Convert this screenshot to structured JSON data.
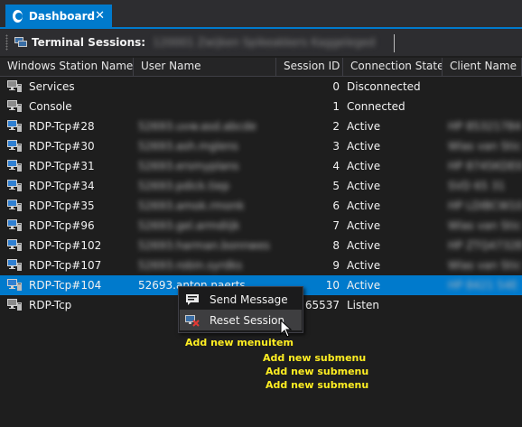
{
  "tab": {
    "title": "Dashboard",
    "close": "✕"
  },
  "toolbar": {
    "label": "Terminal Sessions:",
    "server": "120001 Zwijken Spikeakkers Kaggeleged"
  },
  "columns": [
    "Windows Station Name",
    "User Name",
    "Session ID",
    "Connection State",
    "Client Name"
  ],
  "rows": [
    {
      "station": "Services",
      "user": "",
      "id": "0",
      "state": "Disconnected",
      "client": "",
      "icon": "monitor-gray"
    },
    {
      "station": "Console",
      "user": "",
      "id": "1",
      "state": "Connected",
      "client": "",
      "icon": "monitor-gray"
    },
    {
      "station": "RDP-Tcp#28",
      "user": "52693.uvw.asd.abcde",
      "id": "2",
      "state": "Active",
      "client": "HP 85321784",
      "icon": "monitor-blue"
    },
    {
      "station": "RDP-Tcp#30",
      "user": "52693.ash.mglens",
      "id": "3",
      "state": "Active",
      "client": "Wlas van Sticht",
      "icon": "monitor-blue"
    },
    {
      "station": "RDP-Tcp#31",
      "user": "52693.ersmyplans",
      "id": "4",
      "state": "Active",
      "client": "HP 8745KDE01",
      "icon": "monitor-blue"
    },
    {
      "station": "RDP-Tcp#34",
      "user": "52693.pdick.tiep",
      "id": "5",
      "state": "Active",
      "client": "SVD 65 31",
      "icon": "monitor-blue"
    },
    {
      "station": "RDP-Tcp#35",
      "user": "52693.amok.rmonk",
      "id": "6",
      "state": "Active",
      "client": "HP LDIBCW100",
      "icon": "monitor-blue"
    },
    {
      "station": "RDP-Tcp#96",
      "user": "52693.gel.armdiijk",
      "id": "7",
      "state": "Active",
      "client": "Wlas van Sticht",
      "icon": "monitor-blue"
    },
    {
      "station": "RDP-Tcp#102",
      "user": "52693.harman.bonnwes",
      "id": "8",
      "state": "Active",
      "client": "HP ZTQ4732BKA",
      "icon": "monitor-blue"
    },
    {
      "station": "RDP-Tcp#107",
      "user": "52693.robin.syrdks",
      "id": "9",
      "state": "Active",
      "client": "Wlas van Sticht",
      "icon": "monitor-blue"
    },
    {
      "station": "RDP-Tcp#104",
      "user": "52693.anton.naerts",
      "id": "10",
      "state": "Active",
      "client": "HP 8421 54E",
      "icon": "monitor-blue",
      "selected": true
    },
    {
      "station": "RDP-Tcp",
      "user": "",
      "id": "65537",
      "state": "Listen",
      "client": "",
      "icon": "monitor-gray"
    }
  ],
  "context_menu": {
    "items": [
      {
        "label": "Send Message",
        "icon": "message-icon"
      },
      {
        "label": "Reset Session",
        "icon": "reset-session-icon"
      }
    ]
  },
  "annotations": {
    "menuitem": "Add new menuitem",
    "submenu": [
      "Add new submenu",
      "Add new submenu",
      "Add new submenu"
    ]
  },
  "colors": {
    "accent": "#007acc",
    "annotation": "#ffee22",
    "background": "#1e1e1e"
  }
}
